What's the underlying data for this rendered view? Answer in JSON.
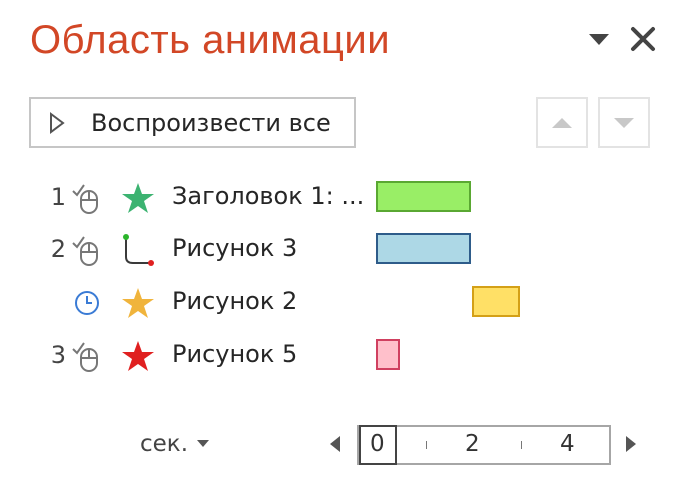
{
  "pane": {
    "title": "Область анимации",
    "title_color": "#d24726",
    "options_icon": "triangle-down-icon",
    "close_icon": "close-icon"
  },
  "toolbar": {
    "play_all_label": "Воспроизвести все",
    "move_up_icon": "triangle-up-icon",
    "move_down_icon": "triangle-down-icon"
  },
  "animations": [
    {
      "number": "1",
      "trigger": "mouse-click-icon",
      "effect": "star-icon",
      "effect_color": "#3cb371",
      "name": "Заголовок 1: ...",
      "bar_fill": "#99ee66",
      "bar_border": "#5aa832",
      "start": 0,
      "duration": 2
    },
    {
      "number": "2",
      "trigger": "mouse-click-icon",
      "effect": "motion-path-icon",
      "effect_color": "#3a3a3a",
      "name": "Рисунок 3",
      "bar_fill": "#add8e6",
      "bar_border": "#2e5c8a",
      "start": 0,
      "duration": 2
    },
    {
      "number": "",
      "trigger": "clock-icon",
      "effect": "star-icon",
      "effect_color": "#f0b43c",
      "name": "Рисунок 2",
      "bar_fill": "#ffe066",
      "bar_border": "#d4a017",
      "start": 2,
      "duration": 1
    },
    {
      "number": "3",
      "trigger": "mouse-click-icon",
      "effect": "star-icon",
      "effect_color": "#e02020",
      "name": "Рисунок 5",
      "bar_fill": "#ffc0cb",
      "bar_border": "#d04060",
      "start": 0,
      "duration": 0.5
    }
  ],
  "timeline": {
    "units_label": "сек.",
    "ticks": [
      "0",
      "2",
      "4"
    ],
    "scroll_left_icon": "triangle-left-icon",
    "scroll_right_icon": "triangle-right-icon"
  }
}
